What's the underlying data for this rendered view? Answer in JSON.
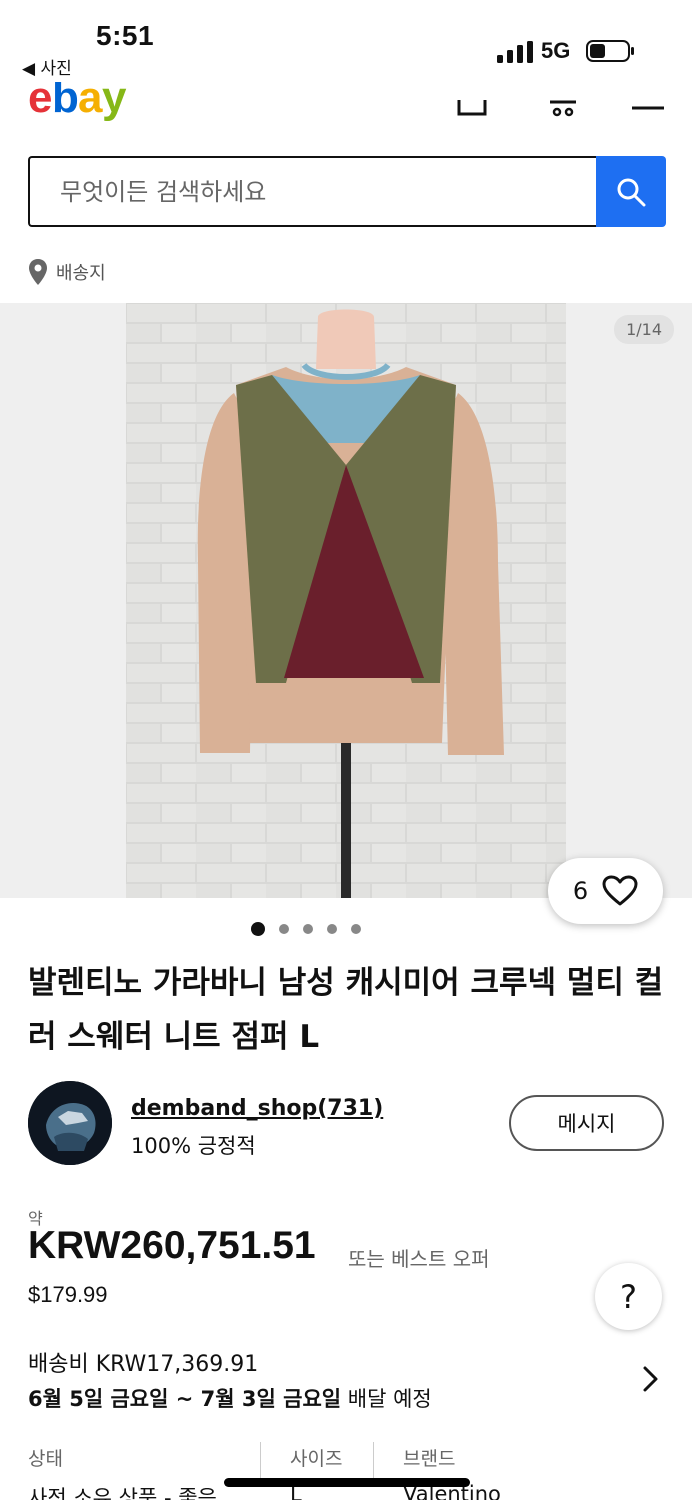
{
  "status_bar": {
    "time": "5:51",
    "back_app": "◀ 사진",
    "network": "5G"
  },
  "search": {
    "placeholder": "무엇이든 검색하세요"
  },
  "ship_to": {
    "label": "배송지"
  },
  "gallery": {
    "counter": "1/14",
    "watch_count": "6",
    "dots_total": 5,
    "dots_active_index": 0
  },
  "product": {
    "title": "발렌티노 가라바니 남성 캐시미어 크루넥 멀티 컬러 스웨터 니트 점퍼 L"
  },
  "seller": {
    "name": "demband_shop(731)",
    "rating": "100% 긍정적",
    "message_label": "메시지"
  },
  "price": {
    "approx": "약",
    "krw": "KRW260,751.51",
    "best_offer": "또는 베스트 오퍼",
    "usd": "$179.99"
  },
  "help_button": "?",
  "shipping": {
    "cost": "배송비 KRW17,369.91",
    "date_start": "6월 5일 금요일",
    "date_sep": " ~ ",
    "date_end": "7월 3일 금요일",
    "date_suffix": " 배달 예정"
  },
  "specs": {
    "headers": [
      "상태",
      "사이즈",
      "브랜드"
    ],
    "values": [
      "사전 소유 상품 - 좋음",
      "L",
      "Valentino"
    ]
  },
  "colors": {
    "accent": "#1e6ff2",
    "text": "#111111",
    "muted": "#666666"
  }
}
